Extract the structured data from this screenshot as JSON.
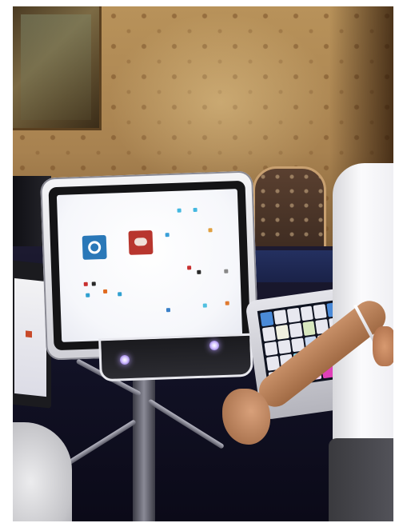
{
  "photo": {
    "subject": "",
    "colors": {
      "wallpaper": "#a88250",
      "floor": "#121226",
      "device_frame": "#f4f4f6",
      "screen": "#ffffff",
      "tile_blue": "#2a78b8",
      "tile_red": "#b8362e",
      "button_glow": "#b8a0ff"
    }
  }
}
